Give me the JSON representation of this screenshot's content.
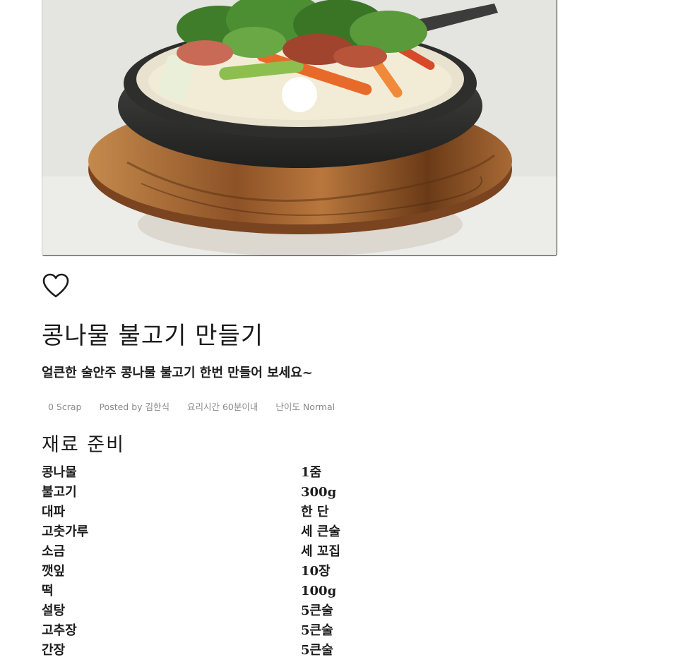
{
  "hero": {
    "image": "cast-iron-skillet-bulgogi-photo",
    "slider_dot_color": "#ffffff"
  },
  "like": {
    "icon": "heart-outline-icon"
  },
  "title": "콩나물 불고기 만들기",
  "subtitle": "얼큰한 술안주 콩나물 불고기 한번 만들어 보세요~",
  "meta": {
    "scrap": "0 Scrap",
    "posted_by": "Posted by 김한식",
    "cook_time": "요리시간 60분이내",
    "difficulty": "난이도 Normal"
  },
  "section_title": "재료 준비",
  "ingredients": [
    {
      "name": "콩나물",
      "qty": "1줌"
    },
    {
      "name": "불고기",
      "qty": "300g"
    },
    {
      "name": "대파",
      "qty": "한 단"
    },
    {
      "name": "고춧가루",
      "qty": "세 큰술"
    },
    {
      "name": "소금",
      "qty": "세 꼬집"
    },
    {
      "name": "깻잎",
      "qty": "10장"
    },
    {
      "name": "떡",
      "qty": "100g"
    },
    {
      "name": "설탕",
      "qty": "5큰술"
    },
    {
      "name": "고추장",
      "qty": "5큰술"
    },
    {
      "name": "간장",
      "qty": "5큰술"
    }
  ]
}
